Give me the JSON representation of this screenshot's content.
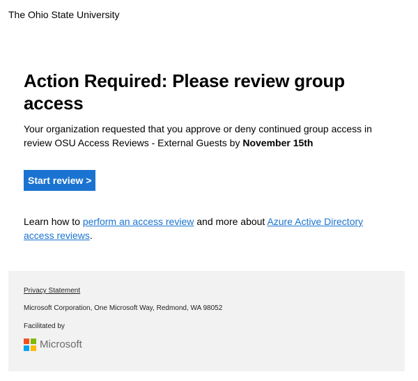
{
  "header": {
    "org_name": "The Ohio State University"
  },
  "email": {
    "title": "Action Required: Please review group access",
    "intro_prefix": "Your organization requested that you approve or deny continued group access in review OSU Access Reviews - External Guests",
    "intro_by": " by ",
    "deadline": "November 15th",
    "cta_label": "Start review >",
    "learn_prefix": "Learn how to ",
    "learn_link1": "perform an access review",
    "learn_mid": " and more about ",
    "learn_link2": "Azure Active Directory access reviews",
    "learn_suffix": "."
  },
  "footer": {
    "privacy_link": "Privacy Statement",
    "address": "Microsoft Corporation, One Microsoft Way, Redmond, WA 98052",
    "facilitated_by": "Facilitated by",
    "logo_text": "Microsoft",
    "logo_icon": "microsoft-logo-icon",
    "logo_colors": [
      "#f25022",
      "#7fba00",
      "#00a4ef",
      "#ffb900"
    ]
  },
  "colors": {
    "accent": "#1a73d0",
    "footer_bg": "#f2f2f2"
  }
}
